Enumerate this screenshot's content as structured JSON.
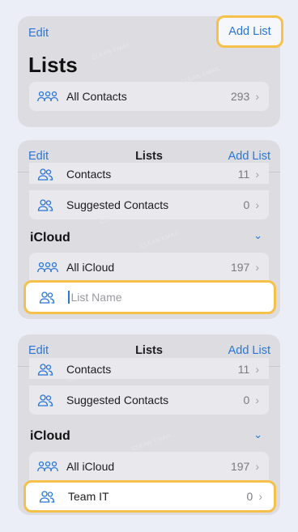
{
  "panel1": {
    "nav_left": "Edit",
    "nav_right": "Add List",
    "title": "Lists",
    "row": {
      "icon": "group-icon",
      "label": "All Contacts",
      "count": "293"
    }
  },
  "panel2": {
    "nav_left": "Edit",
    "nav_title": "Lists",
    "nav_right": "Add List",
    "rows_top": [
      {
        "icon": "person-icon",
        "label": "Contacts",
        "count": "11"
      },
      {
        "icon": "person-icon",
        "label": "Suggested Contacts",
        "count": "0"
      }
    ],
    "section": "iCloud",
    "rows_bottom": [
      {
        "icon": "group-icon",
        "label": "All iCloud",
        "count": "197"
      }
    ],
    "input": {
      "icon": "person-icon",
      "placeholder": "List Name"
    }
  },
  "panel3": {
    "nav_left": "Edit",
    "nav_title": "Lists",
    "nav_right": "Add List",
    "rows_top": [
      {
        "icon": "person-icon",
        "label": "Contacts",
        "count": "11"
      },
      {
        "icon": "person-icon",
        "label": "Suggested Contacts",
        "count": "0"
      }
    ],
    "section": "iCloud",
    "rows_bottom": [
      {
        "icon": "group-icon",
        "label": "All iCloud",
        "count": "197"
      }
    ],
    "new_row": {
      "icon": "person-icon",
      "label": "Team IT",
      "count": "0"
    }
  },
  "chevron": "›",
  "section_chevron": "⌄",
  "watermark": "CLEAN EMAIL",
  "colors": {
    "accent": "#2a76d8",
    "highlight": "#f5c14b"
  }
}
